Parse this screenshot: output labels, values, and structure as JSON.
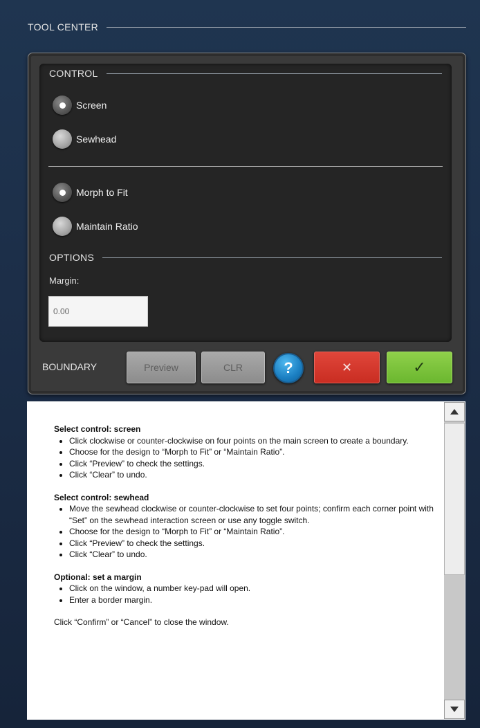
{
  "window": {
    "title": "TOOL CENTER"
  },
  "control": {
    "title": "CONTROL",
    "source_options": [
      {
        "label": "Screen",
        "selected": true
      },
      {
        "label": "Sewhead",
        "selected": false
      }
    ],
    "fit_options": [
      {
        "label": "Morph to Fit",
        "selected": true
      },
      {
        "label": "Maintain Ratio",
        "selected": false
      }
    ]
  },
  "options": {
    "title": "OPTIONS",
    "margin_label": "Margin:",
    "margin_value": "0.00"
  },
  "toolbar": {
    "boundary_label": "BOUNDARY",
    "preview_label": "Preview",
    "clr_label": "CLR",
    "help_label": "?",
    "cancel_label": "✕",
    "confirm_label": "✓"
  },
  "help": {
    "sections": [
      {
        "heading": "Select control: screen",
        "bullets": [
          "Click clockwise or counter-clockwise on four points on the main screen to create a boundary.",
          "Choose for the design to “Morph to Fit” or “Maintain Ratio”.",
          "Click “Preview”  to check the settings.",
          "Click “Clear” to undo."
        ]
      },
      {
        "heading": "Select control: sewhead",
        "bullets": [
          "Move the sewhead clockwise or counter-clockwise to set four points; confirm each corner point with “Set” on the sewhead interaction screen or use any toggle switch.",
          "Choose for the design to “Morph to Fit” or “Maintain Ratio”.",
          "Click “Preview” to check the settings.",
          "Click “Clear” to undo."
        ]
      },
      {
        "heading": "Optional: set a margin",
        "bullets": [
          "Click on the window, a number key-pad will open.",
          "Enter a border margin."
        ]
      }
    ],
    "footer": "Click “Confirm” or “Cancel” to close the window."
  }
}
